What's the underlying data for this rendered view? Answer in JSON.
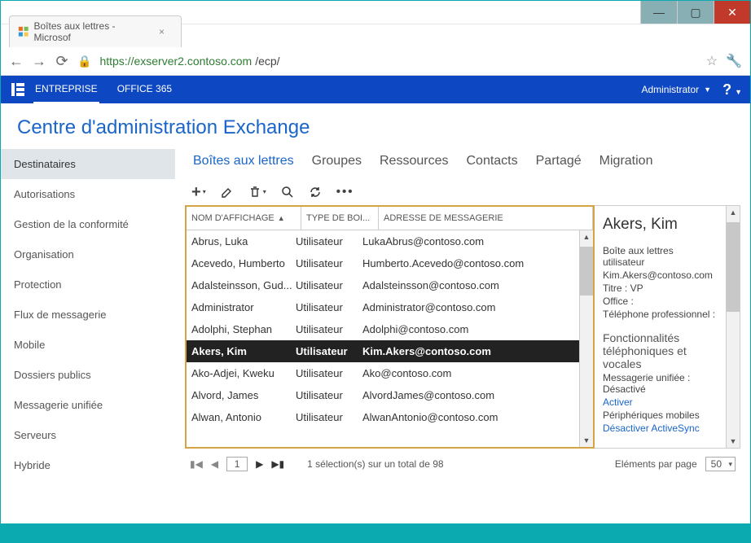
{
  "browser": {
    "tab_title": "Boîtes aux lettres - Microsof",
    "url_host": "https://exserver2.contoso.com",
    "url_path": "/ecp/"
  },
  "o365": {
    "tabs": [
      "ENTREPRISE",
      "OFFICE 365"
    ],
    "active_tab": 0,
    "user_label": "Administrator",
    "help_glyph": "?"
  },
  "page_title": "Centre d'administration Exchange",
  "sidebar": {
    "items": [
      "Destinataires",
      "Autorisations",
      "Gestion de la conformité",
      "Organisation",
      "Protection",
      "Flux de messagerie",
      "Mobile",
      "Dossiers publics",
      "Messagerie unifiée",
      "Serveurs",
      "Hybride"
    ],
    "selected": 0
  },
  "subtabs": {
    "items": [
      "Boîtes aux lettres",
      "Groupes",
      "Ressources",
      "Contacts",
      "Partagé",
      "Migration"
    ],
    "selected": 0
  },
  "columns": {
    "name": "NOM D'AFFICHAGE",
    "type": "TYPE DE BOI...",
    "email": "ADRESSE DE MESSAGERIE"
  },
  "rows": [
    {
      "name": "Abrus, Luka",
      "type": "Utilisateur",
      "email": "LukaAbrus@contoso.com"
    },
    {
      "name": "Acevedo, Humberto",
      "type": "Utilisateur",
      "email": "Humberto.Acevedo@contoso.com"
    },
    {
      "name": "Adalsteinsson, Gud...",
      "type": "Utilisateur",
      "email": "Adalsteinsson@contoso.com"
    },
    {
      "name": "Administrator",
      "type": "Utilisateur",
      "email": "Administrator@contoso.com"
    },
    {
      "name": "Adolphi, Stephan",
      "type": "Utilisateur",
      "email": "Adolphi@contoso.com"
    },
    {
      "name": "Akers, Kim",
      "type": "Utilisateur",
      "email": "Kim.Akers@contoso.com"
    },
    {
      "name": "Ako-Adjei, Kweku",
      "type": "Utilisateur",
      "email": "Ako@contoso.com"
    },
    {
      "name": "Alvord, James",
      "type": "Utilisateur",
      "email": "AlvordJames@contoso.com"
    },
    {
      "name": "Alwan, Antonio",
      "type": "Utilisateur",
      "email": "AlwanAntonio@contoso.com"
    }
  ],
  "selected_row": 5,
  "details": {
    "title": "Akers, Kim",
    "type_line": "Boîte aux lettres utilisateur",
    "email": "Kim.Akers@contoso.com",
    "title_label": "Titre :",
    "title_value": "VP",
    "office_label": "Office :",
    "phone_label": "Téléphone professionnel :",
    "section2": "Fonctionnalités téléphoniques et vocales",
    "um_label": "Messagerie unifiée :",
    "um_value": "Désactivé",
    "um_link": "Activer",
    "mobile_label": "Périphériques mobiles",
    "mobile_link": "Désactiver ActiveSync"
  },
  "pager": {
    "page": "1",
    "status": "1 sélection(s) sur un total de 98",
    "ipp_label": "Eléments par page",
    "ipp_value": "50"
  }
}
